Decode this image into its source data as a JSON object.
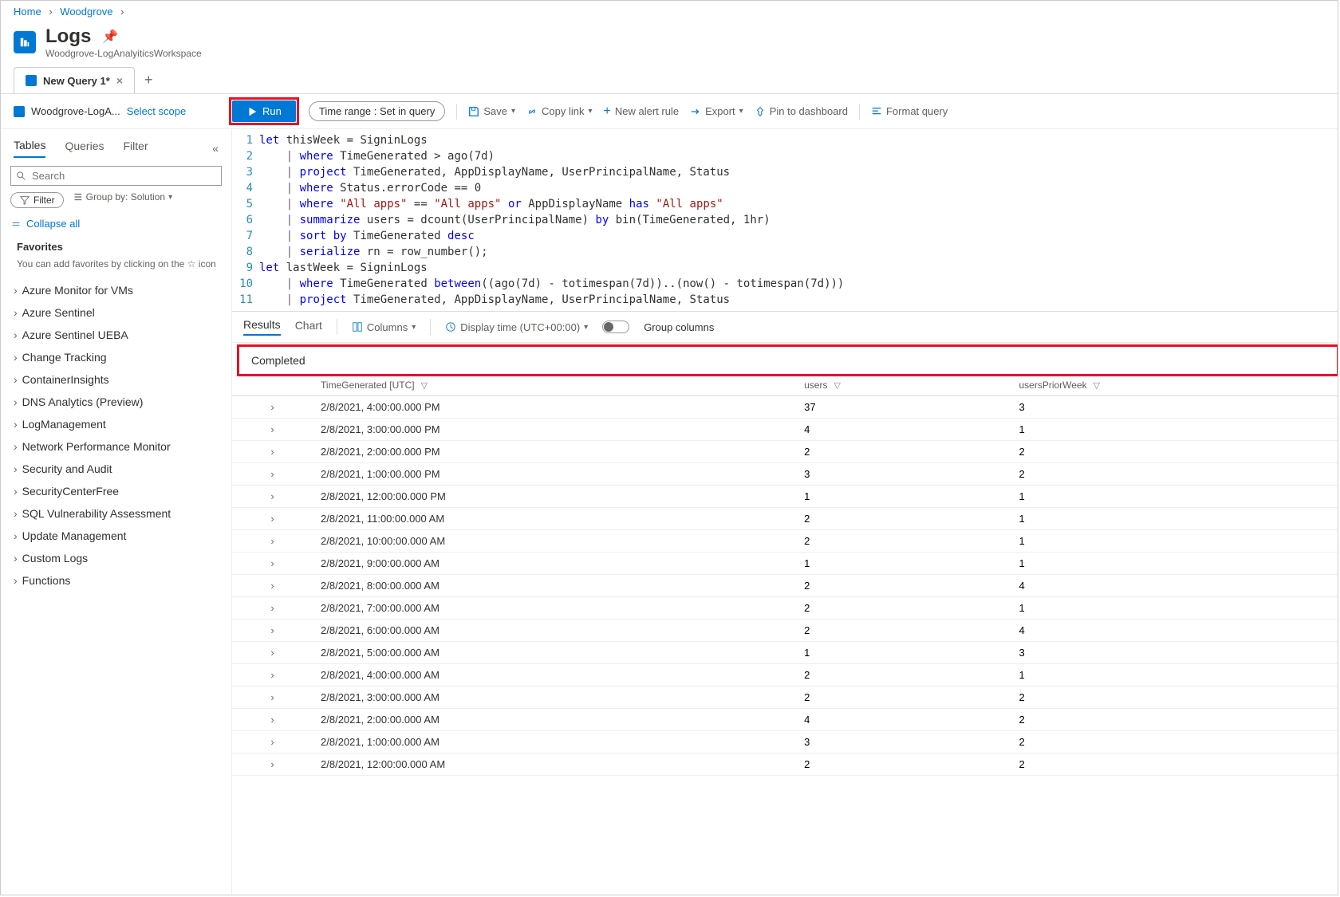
{
  "breadcrumb": {
    "home": "Home",
    "item1": "Woodgrove"
  },
  "header": {
    "title": "Logs",
    "subtitle": "Woodgrove-LogAnalyiticsWorkspace"
  },
  "queryTab": {
    "label": "New Query 1*"
  },
  "scope": {
    "name": "Woodgrove-LogA...",
    "select": "Select scope"
  },
  "toolbar": {
    "run": "Run",
    "timeRangeLabel": "Time range :",
    "timeRangeValue": "Set in query",
    "save": "Save",
    "copyLink": "Copy link",
    "newAlert": "New alert rule",
    "export": "Export",
    "pin": "Pin to dashboard",
    "format": "Format query"
  },
  "sidebar": {
    "tabs": {
      "tables": "Tables",
      "queries": "Queries",
      "filter": "Filter"
    },
    "searchPlaceholder": "Search",
    "filterChip": "Filter",
    "groupBy": "Group by: Solution",
    "collapseAll": "Collapse all",
    "favoritesTitle": "Favorites",
    "favoritesHint": "You can add favorites by clicking on the ☆ icon",
    "items": [
      "Azure Monitor for VMs",
      "Azure Sentinel",
      "Azure Sentinel UEBA",
      "Change Tracking",
      "ContainerInsights",
      "DNS Analytics (Preview)",
      "LogManagement",
      "Network Performance Monitor",
      "Security and Audit",
      "SecurityCenterFree",
      "SQL Vulnerability Assessment",
      "Update Management",
      "Custom Logs",
      "Functions"
    ]
  },
  "code": {
    "lines": [
      "let thisWeek = SigninLogs",
      "    | where TimeGenerated > ago(7d)",
      "    | project TimeGenerated, AppDisplayName, UserPrincipalName, Status",
      "    | where Status.errorCode == 0",
      "    | where \"All apps\" == \"All apps\" or AppDisplayName has \"All apps\"",
      "    | summarize users = dcount(UserPrincipalName) by bin(TimeGenerated, 1hr)",
      "    | sort by TimeGenerated desc",
      "    | serialize rn = row_number();",
      "let lastWeek = SigninLogs",
      "    | where TimeGenerated between((ago(7d) - totimespan(7d))..(now() - totimespan(7d)))",
      "    | project TimeGenerated, AppDisplayName, UserPrincipalName, Status"
    ]
  },
  "resultsBar": {
    "results": "Results",
    "chart": "Chart",
    "columns": "Columns",
    "displayTime": "Display time (UTC+00:00)",
    "groupColumns": "Group columns"
  },
  "status": {
    "completed": "Completed"
  },
  "table": {
    "headers": {
      "time": "TimeGenerated [UTC]",
      "users": "users",
      "usersPrior": "usersPriorWeek"
    },
    "rows": [
      {
        "time": "2/8/2021, 4:00:00.000 PM",
        "users": "37",
        "prior": "3"
      },
      {
        "time": "2/8/2021, 3:00:00.000 PM",
        "users": "4",
        "prior": "1"
      },
      {
        "time": "2/8/2021, 2:00:00.000 PM",
        "users": "2",
        "prior": "2"
      },
      {
        "time": "2/8/2021, 1:00:00.000 PM",
        "users": "3",
        "prior": "2"
      },
      {
        "time": "2/8/2021, 12:00:00.000 PM",
        "users": "1",
        "prior": "1"
      },
      {
        "time": "2/8/2021, 11:00:00.000 AM",
        "users": "2",
        "prior": "1"
      },
      {
        "time": "2/8/2021, 10:00:00.000 AM",
        "users": "2",
        "prior": "1"
      },
      {
        "time": "2/8/2021, 9:00:00.000 AM",
        "users": "1",
        "prior": "1"
      },
      {
        "time": "2/8/2021, 8:00:00.000 AM",
        "users": "2",
        "prior": "4"
      },
      {
        "time": "2/8/2021, 7:00:00.000 AM",
        "users": "2",
        "prior": "1"
      },
      {
        "time": "2/8/2021, 6:00:00.000 AM",
        "users": "2",
        "prior": "4"
      },
      {
        "time": "2/8/2021, 5:00:00.000 AM",
        "users": "1",
        "prior": "3"
      },
      {
        "time": "2/8/2021, 4:00:00.000 AM",
        "users": "2",
        "prior": "1"
      },
      {
        "time": "2/8/2021, 3:00:00.000 AM",
        "users": "2",
        "prior": "2"
      },
      {
        "time": "2/8/2021, 2:00:00.000 AM",
        "users": "4",
        "prior": "2"
      },
      {
        "time": "2/8/2021, 1:00:00.000 AM",
        "users": "3",
        "prior": "2"
      },
      {
        "time": "2/8/2021, 12:00:00.000 AM",
        "users": "2",
        "prior": "2"
      }
    ]
  }
}
